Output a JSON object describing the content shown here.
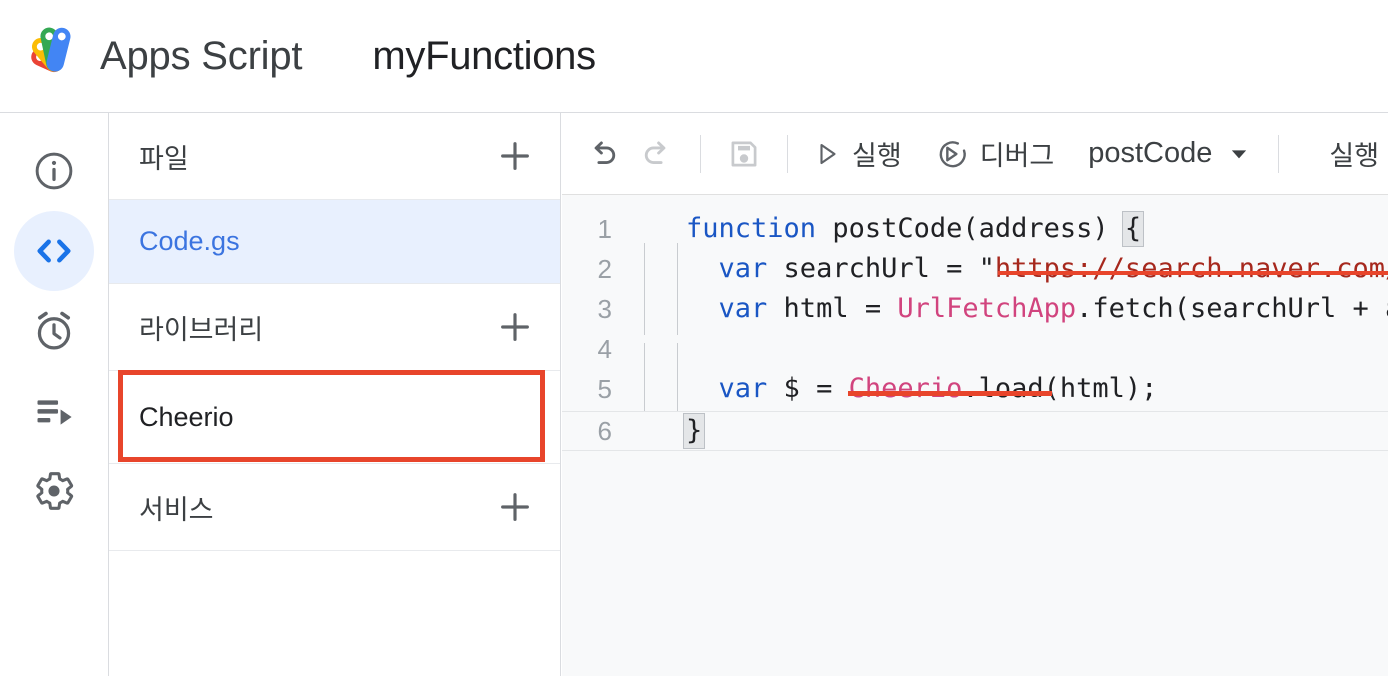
{
  "header": {
    "logo_name": "apps-script-logo",
    "app_title": "Apps Script",
    "doc_title": "myFunctions",
    "logo_colors": [
      "#ea4335",
      "#fbbc04",
      "#34a853",
      "#4285f4"
    ]
  },
  "rail": {
    "items": [
      {
        "icon": "info-icon",
        "name": "overview",
        "active": false
      },
      {
        "icon": "code-icon",
        "name": "editor",
        "active": true
      },
      {
        "icon": "alarm-clock-icon",
        "name": "triggers",
        "active": false
      },
      {
        "icon": "executions-icon",
        "name": "executions",
        "active": false
      },
      {
        "icon": "gear-icon",
        "name": "settings",
        "active": false
      }
    ]
  },
  "files_panel": {
    "sections": {
      "files": {
        "label": "파일",
        "add_icon": "plus-icon"
      },
      "libraries": {
        "label": "라이브러리",
        "add_icon": "plus-icon"
      },
      "services": {
        "label": "서비스",
        "add_icon": "plus-icon"
      }
    },
    "files": [
      {
        "name": "Code.gs",
        "selected": true
      }
    ],
    "libraries": [
      {
        "name": "Cheerio",
        "selected": false,
        "annotated": true
      }
    ]
  },
  "toolbar": {
    "undo": {
      "icon": "undo-icon",
      "enabled": true
    },
    "redo": {
      "icon": "redo-icon",
      "enabled": false
    },
    "save": {
      "icon": "save-icon",
      "enabled": false
    },
    "run": {
      "icon": "play-icon",
      "label": "실행"
    },
    "debug": {
      "icon": "debug-icon",
      "label": "디버그"
    },
    "function_select": {
      "value": "postCode",
      "icon": "chevron-down-icon"
    },
    "executions_label": "실행"
  },
  "code": {
    "line_numbers": [
      "1",
      "2",
      "3",
      "4",
      "5",
      "6"
    ],
    "lines": [
      {
        "n": "1",
        "tokens": [
          {
            "t": "function",
            "c": "kw"
          },
          {
            "t": " ",
            "c": "plain"
          },
          {
            "t": "postCode",
            "c": "fn-name"
          },
          {
            "t": "(address) ",
            "c": "plain"
          },
          {
            "t": "{",
            "c": "brace"
          }
        ]
      },
      {
        "n": "2",
        "tokens": [
          {
            "t": "  ",
            "c": "plain"
          },
          {
            "t": "var",
            "c": "kw"
          },
          {
            "t": " searchUrl = ",
            "c": "plain"
          },
          {
            "t": "\"",
            "c": "plain"
          },
          {
            "t": "https://search.naver.com/",
            "c": "str"
          }
        ]
      },
      {
        "n": "3",
        "tokens": [
          {
            "t": "  ",
            "c": "plain"
          },
          {
            "t": "var",
            "c": "kw"
          },
          {
            "t": " html = ",
            "c": "plain"
          },
          {
            "t": "UrlFetchApp",
            "c": "cls"
          },
          {
            "t": ".fetch(searchUrl + a",
            "c": "plain"
          }
        ]
      },
      {
        "n": "4",
        "tokens": []
      },
      {
        "n": "5",
        "tokens": [
          {
            "t": "  ",
            "c": "plain"
          },
          {
            "t": "var",
            "c": "kw"
          },
          {
            "t": " $ = ",
            "c": "plain"
          },
          {
            "t": "Cheerio",
            "c": "cls"
          },
          {
            "t": ".load(html);",
            "c": "plain"
          }
        ]
      },
      {
        "n": "6",
        "tokens": [
          {
            "t": "}",
            "c": "brace"
          }
        ]
      }
    ],
    "full_text_line1": "function postCode(address) {",
    "full_text_line2": "  var searchUrl = \"https://search.naver.com/",
    "full_text_line3": "  var html = UrlFetchApp.fetch(searchUrl + a",
    "full_text_line5": "  var $ = Cheerio.load(html);",
    "full_text_line6": "}"
  },
  "annotations": {
    "color": "#e8452b",
    "box_target": "Cheerio",
    "underline_target": "Cheerio"
  }
}
